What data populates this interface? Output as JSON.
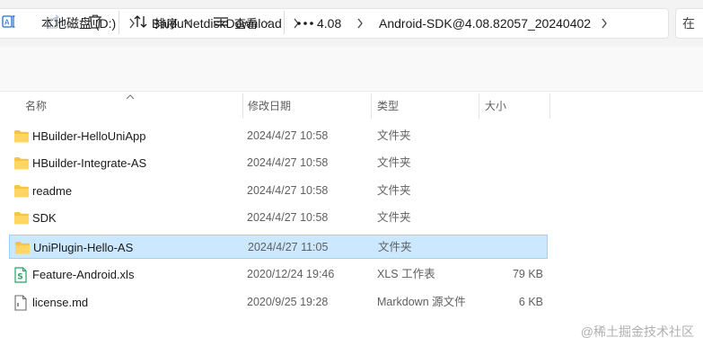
{
  "breadcrumb": {
    "items": [
      "本地磁盘 (D:)",
      "BaiduNetdiskDownload",
      "4.08",
      "Android-SDK@4.08.82057_20240402"
    ],
    "search_placeholder": "在"
  },
  "toolbar": {
    "sort_label": "排序",
    "view_label": "查看"
  },
  "columns": {
    "name": "名称",
    "date": "修改日期",
    "type": "类型",
    "size": "大小"
  },
  "files": [
    {
      "name": "HBuilder-HelloUniApp",
      "date": "2024/4/27 10:58",
      "type": "文件夹",
      "size": "",
      "icon": "folder-icon"
    },
    {
      "name": "HBuilder-Integrate-AS",
      "date": "2024/4/27 10:58",
      "type": "文件夹",
      "size": "",
      "icon": "folder-icon"
    },
    {
      "name": "readme",
      "date": "2024/4/27 10:58",
      "type": "文件夹",
      "size": "",
      "icon": "folder-icon"
    },
    {
      "name": "SDK",
      "date": "2024/4/27 10:58",
      "type": "文件夹",
      "size": "",
      "icon": "folder-icon"
    },
    {
      "name": "UniPlugin-Hello-AS",
      "date": "2024/4/27 11:05",
      "type": "文件夹",
      "size": "",
      "icon": "folder-icon",
      "selected": true
    },
    {
      "name": "Feature-Android.xls",
      "date": "2020/12/24 19:46",
      "type": "XLS 工作表",
      "size": "79 KB",
      "icon": "spreadsheet-icon"
    },
    {
      "name": "license.md",
      "date": "2020/9/25 19:28",
      "type": "Markdown 源文件",
      "size": "6 KB",
      "icon": "document-icon"
    }
  ],
  "watermark": "@稀土掘金技术社区",
  "colors": {
    "selection_bg": "#cce8ff",
    "selection_border": "#99d1ff",
    "folder": "#f5c542",
    "spreadsheet": "#21a366"
  }
}
